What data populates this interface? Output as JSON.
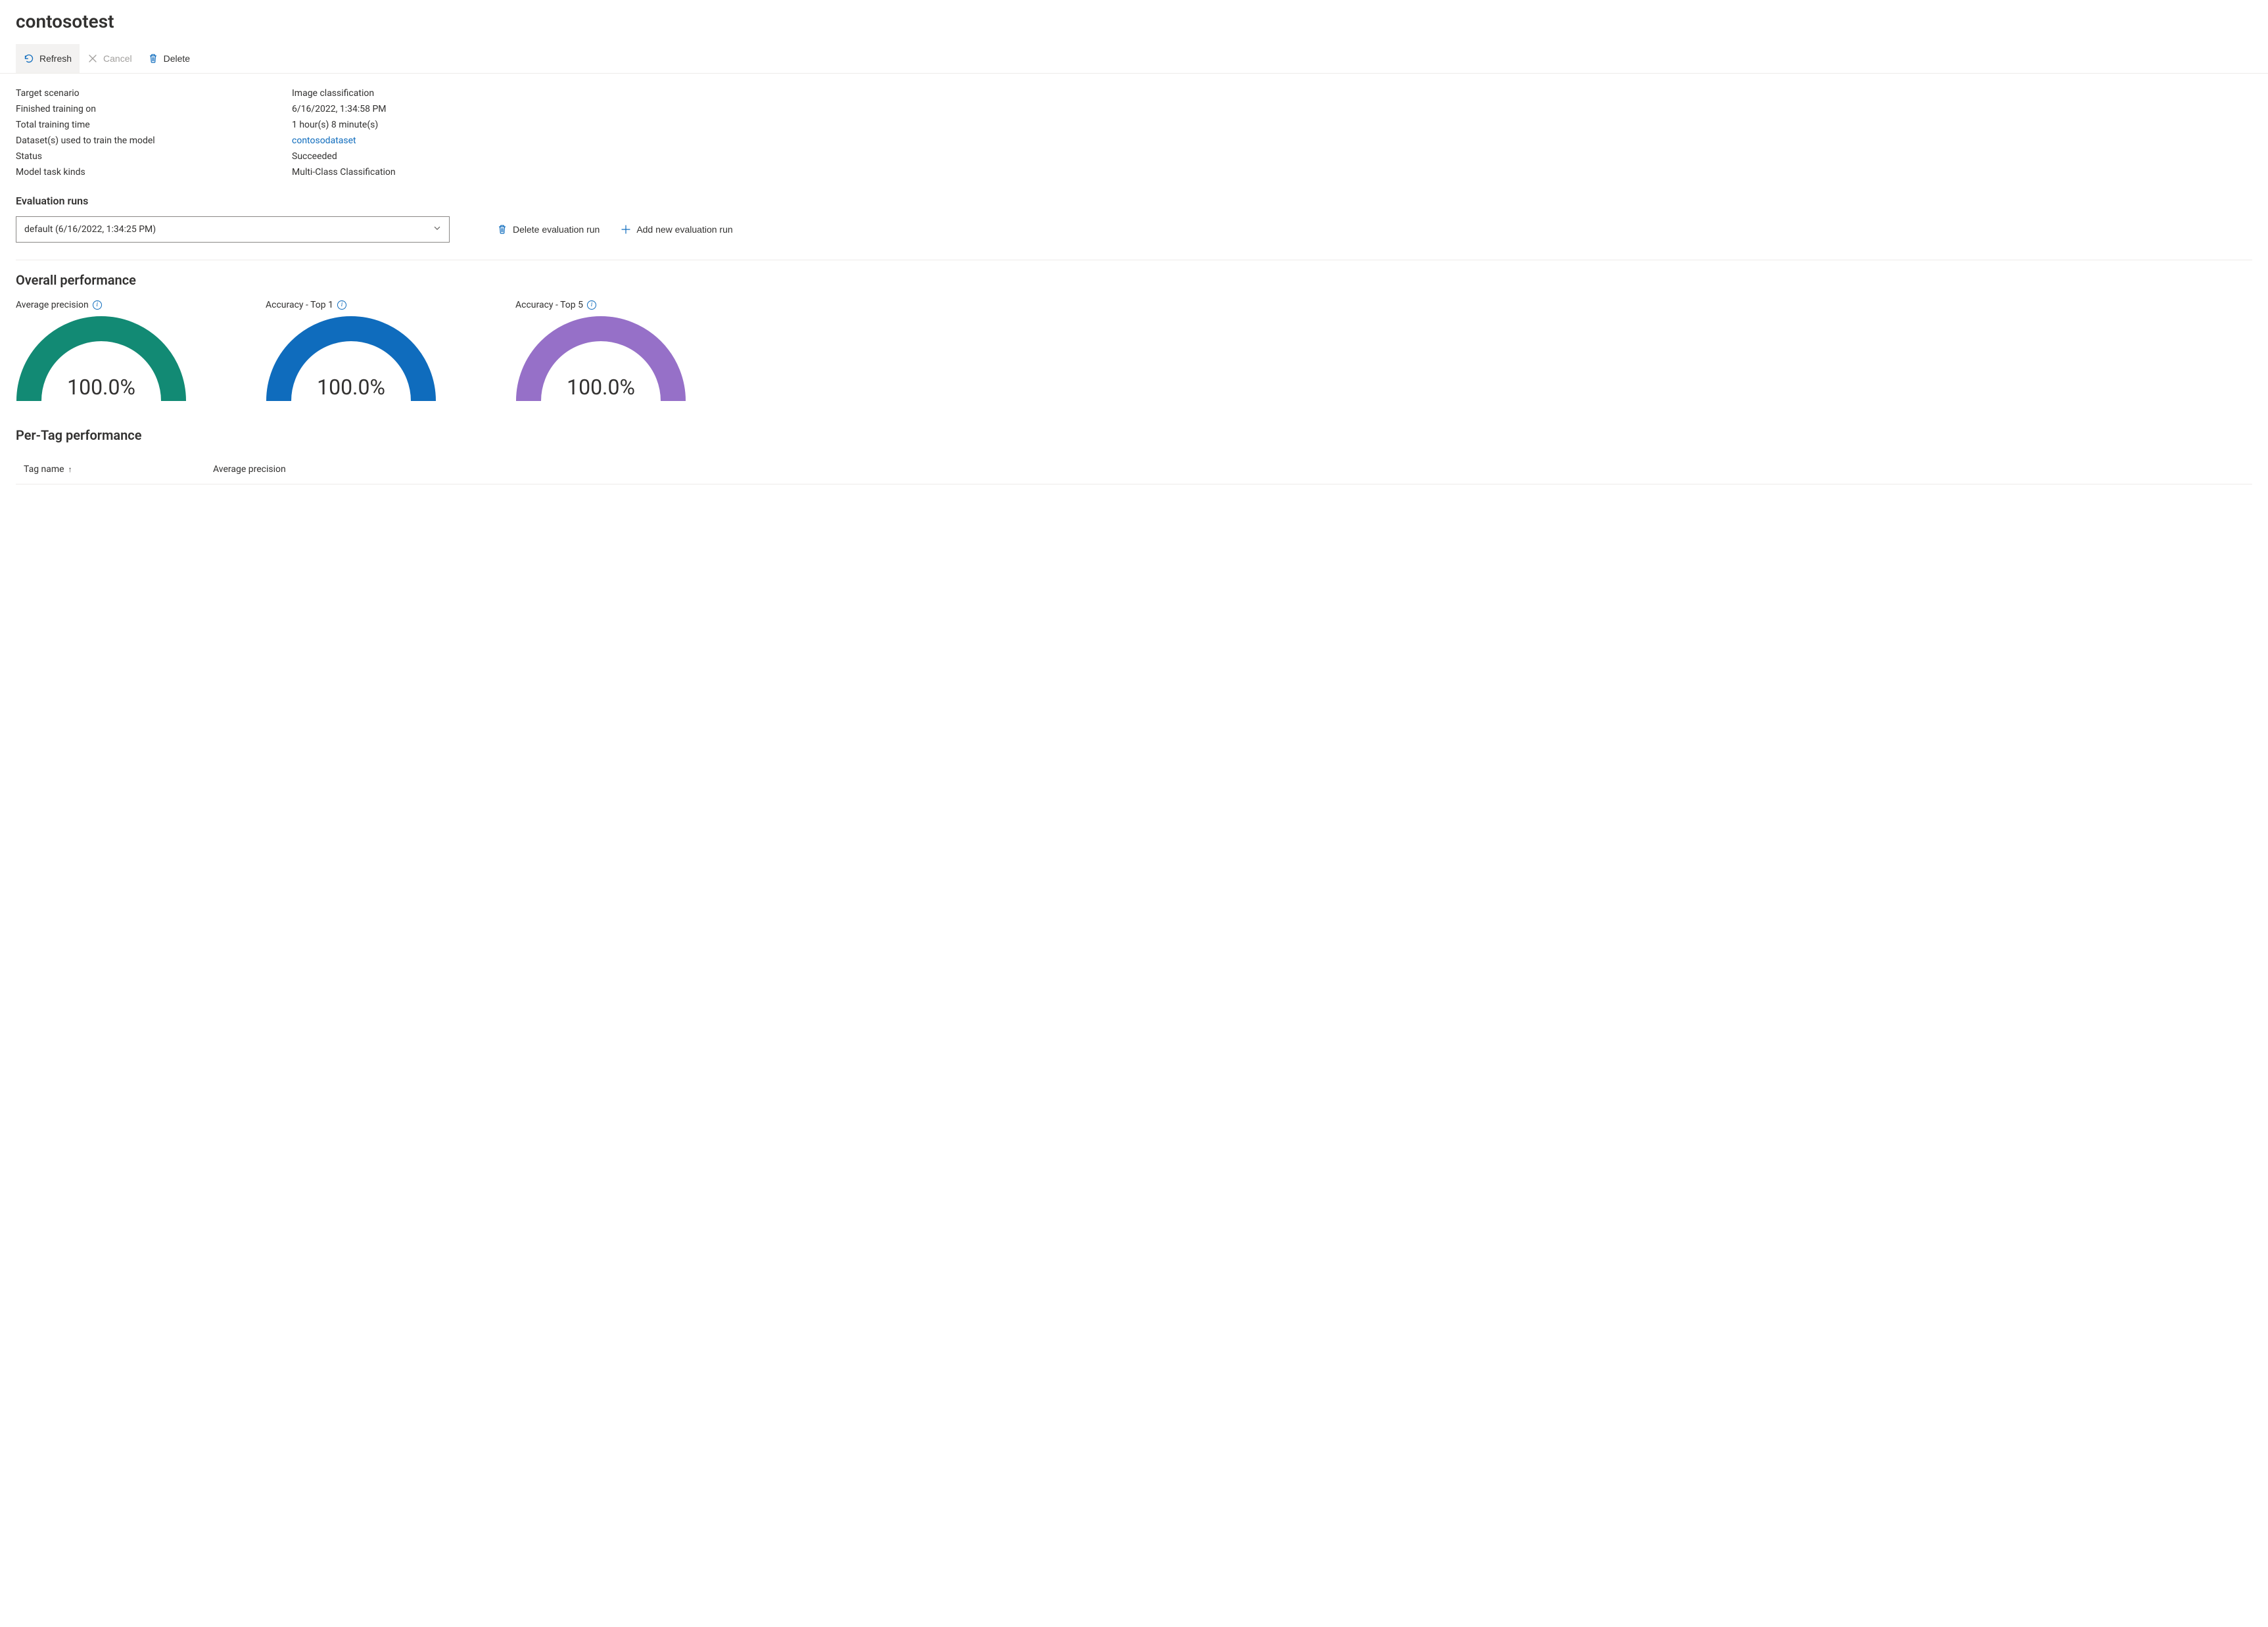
{
  "page": {
    "title": "contosotest"
  },
  "toolbar": {
    "refresh": "Refresh",
    "cancel": "Cancel",
    "delete": "Delete"
  },
  "details": {
    "labels": {
      "target_scenario": "Target scenario",
      "finished_training_on": "Finished training on",
      "total_training_time": "Total training time",
      "datasets_used": "Dataset(s) used to train the model",
      "status": "Status",
      "model_task_kinds": "Model task kinds"
    },
    "values": {
      "target_scenario": "Image classification",
      "finished_training_on": "6/16/2022, 1:34:58 PM",
      "total_training_time": "1 hour(s) 8 minute(s)",
      "datasets_used": "contosodataset",
      "status": "Succeeded",
      "model_task_kinds": "Multi-Class Classification"
    }
  },
  "eval_runs": {
    "heading": "Evaluation runs",
    "selected": "default (6/16/2022, 1:34:25 PM)",
    "delete_label": "Delete evaluation run",
    "add_label": "Add new evaluation run"
  },
  "overall_performance": {
    "heading": "Overall performance",
    "metrics": [
      {
        "label": "Average precision",
        "value_text": "100.0%",
        "value_pct": 100.0,
        "color": "#128a74"
      },
      {
        "label": "Accuracy - Top 1",
        "value_text": "100.0%",
        "value_pct": 100.0,
        "color": "#0f6cbd"
      },
      {
        "label": "Accuracy - Top 5",
        "value_text": "100.0%",
        "value_pct": 100.0,
        "color": "#9670c8"
      }
    ]
  },
  "per_tag": {
    "heading": "Per-Tag performance",
    "columns": {
      "tag_name": "Tag name",
      "average_precision": "Average precision"
    },
    "sort_indicator": "↑"
  },
  "chart_data": [
    {
      "type": "bar",
      "title": "Average precision",
      "categories": [
        "Average precision"
      ],
      "values": [
        100.0
      ],
      "ylim": [
        0,
        100
      ],
      "xlabel": "",
      "ylabel": "%"
    },
    {
      "type": "bar",
      "title": "Accuracy - Top 1",
      "categories": [
        "Accuracy - Top 1"
      ],
      "values": [
        100.0
      ],
      "ylim": [
        0,
        100
      ],
      "xlabel": "",
      "ylabel": "%"
    },
    {
      "type": "bar",
      "title": "Accuracy - Top 5",
      "categories": [
        "Accuracy - Top 5"
      ],
      "values": [
        100.0
      ],
      "ylim": [
        0,
        100
      ],
      "xlabel": "",
      "ylabel": "%"
    }
  ],
  "colors": {
    "link": "#0f6cbd",
    "accent_blue": "#0f6cbd"
  }
}
